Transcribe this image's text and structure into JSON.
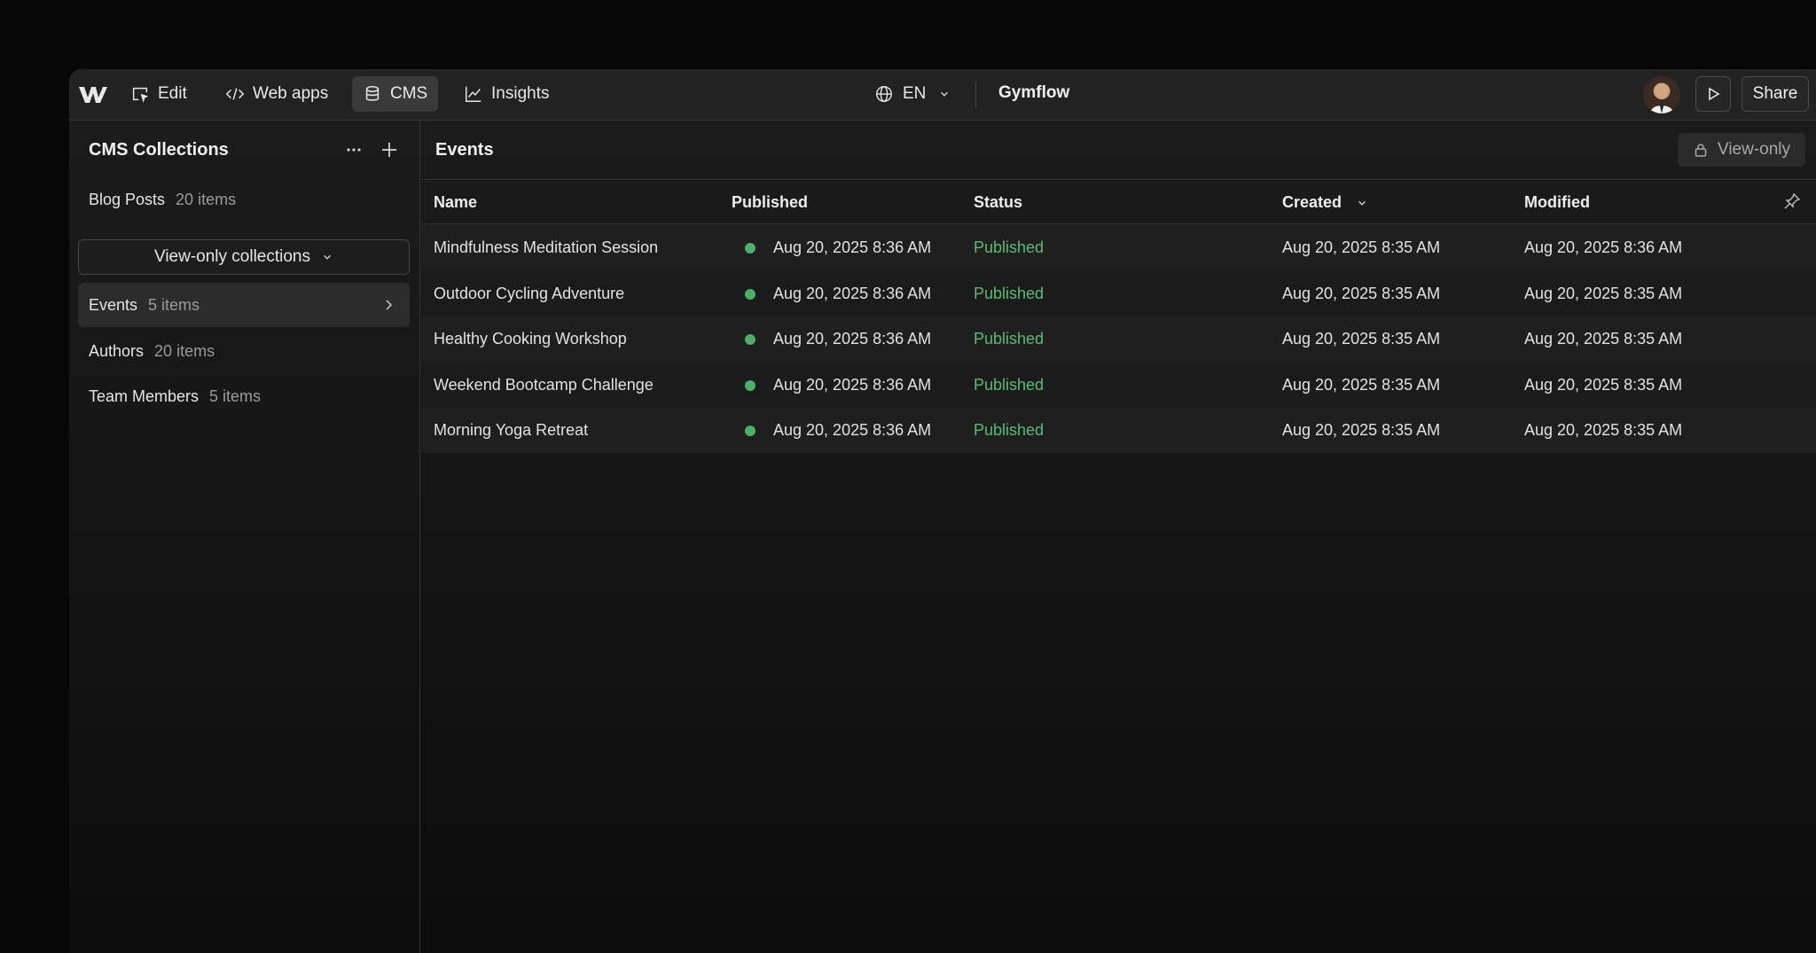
{
  "colors": {
    "accent_green": "#5dba76",
    "dot_green": "#4caf6a",
    "background": "#070707"
  },
  "topbar": {
    "logo": "webflow-logo",
    "nav": [
      {
        "label": "Edit",
        "icon": "edit-cursor-icon"
      },
      {
        "label": "Web apps",
        "icon": "code-icon"
      },
      {
        "label": "CMS",
        "icon": "database-icon"
      },
      {
        "label": "Insights",
        "icon": "chart-line-icon"
      }
    ],
    "language": "EN",
    "site_name": "Gymflow",
    "share_label": "Share"
  },
  "sidebar": {
    "title": "CMS Collections",
    "collections": [
      {
        "name": "Blog Posts",
        "count": "20 items"
      }
    ],
    "view_only_label": "View-only collections",
    "view_only_collections": [
      {
        "name": "Events",
        "count": "5 items"
      },
      {
        "name": "Authors",
        "count": "20 items"
      },
      {
        "name": "Team Members",
        "count": "5 items"
      }
    ]
  },
  "main": {
    "title": "Events",
    "view_only_badge": "View-only",
    "columns": [
      "Name",
      "Published",
      "Status",
      "Created",
      "Modified"
    ],
    "rows": [
      {
        "name": "Mindfulness Meditation Session",
        "published": "Aug 20, 2025 8:36 AM",
        "status": "Published",
        "created": "Aug 20, 2025 8:35 AM",
        "modified": "Aug 20, 2025 8:36 AM"
      },
      {
        "name": "Outdoor Cycling Adventure",
        "published": "Aug 20, 2025 8:36 AM",
        "status": "Published",
        "created": "Aug 20, 2025 8:35 AM",
        "modified": "Aug 20, 2025 8:35 AM"
      },
      {
        "name": "Healthy Cooking Workshop",
        "published": "Aug 20, 2025 8:36 AM",
        "status": "Published",
        "created": "Aug 20, 2025 8:35 AM",
        "modified": "Aug 20, 2025 8:35 AM"
      },
      {
        "name": "Weekend Bootcamp Challenge",
        "published": "Aug 20, 2025 8:36 AM",
        "status": "Published",
        "created": "Aug 20, 2025 8:35 AM",
        "modified": "Aug 20, 2025 8:35 AM"
      },
      {
        "name": "Morning Yoga Retreat",
        "published": "Aug 20, 2025 8:36 AM",
        "status": "Published",
        "created": "Aug 20, 2025 8:35 AM",
        "modified": "Aug 20, 2025 8:35 AM"
      }
    ]
  }
}
